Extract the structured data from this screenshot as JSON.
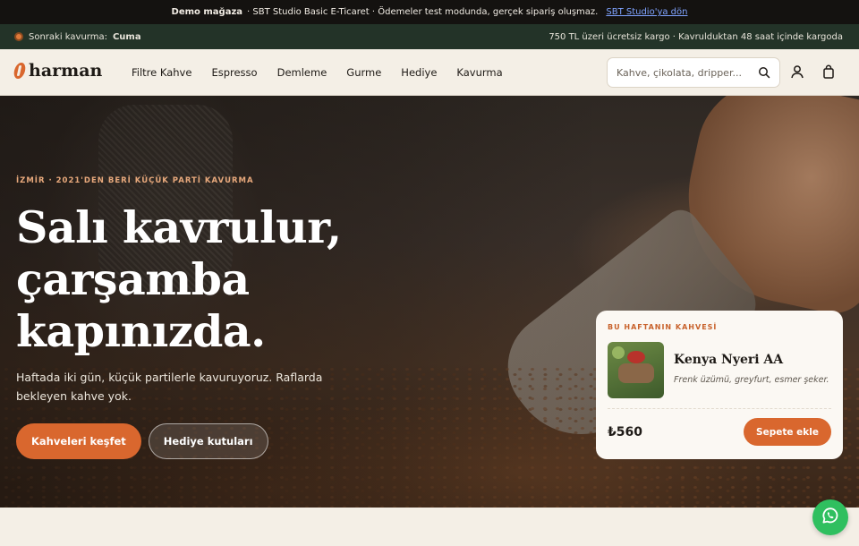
{
  "demo_bar": {
    "brand": "Demo mağaza",
    "text": "· SBT Studio Basic E-Ticaret · Ödemeler test modunda, gerçek sipariş oluşmaz.",
    "link": "SBT Studio'ya dön"
  },
  "info_bar": {
    "roast_label": "Sonraki kavurma:",
    "roast_day": "Cuma",
    "shipping": "750 TL üzeri ücretsiz kargo · Kavrulduktan 48 saat içinde kargoda"
  },
  "header": {
    "logo": "harman",
    "nav": [
      "Filtre Kahve",
      "Espresso",
      "Demleme",
      "Gurme",
      "Hediye",
      "Kavurma"
    ],
    "search_placeholder": "Kahve, çikolata, dripper..."
  },
  "hero": {
    "eyebrow": "İZMİR · 2021'DEN BERİ KÜÇÜK PARTİ KAVURMA",
    "title": "Salı kavrulur, çarşamba kapınızda.",
    "subtitle": "Haftada iki gün, küçük partilerle kavuruyoruz. Raflarda bekleyen kahve yok.",
    "primary_button": "Kahveleri keşfet",
    "secondary_button": "Hediye kutuları"
  },
  "weekly_card": {
    "kicker": "BU HAFTANIN KAHVESİ",
    "product_name": "Kenya Nyeri AA",
    "notes": "Frenk üzümü, greyfurt, esmer şeker.",
    "price": "₺560",
    "add_button": "Sepete ekle"
  },
  "colors": {
    "accent": "#d9672e",
    "info_bar": "#233328",
    "demo_bar": "#141210",
    "background": "#f4efe6",
    "whatsapp": "#2fbf5f"
  },
  "icons": [
    "search-icon",
    "user-icon",
    "cart-icon",
    "whatsapp-icon",
    "roast-dot-icon"
  ]
}
